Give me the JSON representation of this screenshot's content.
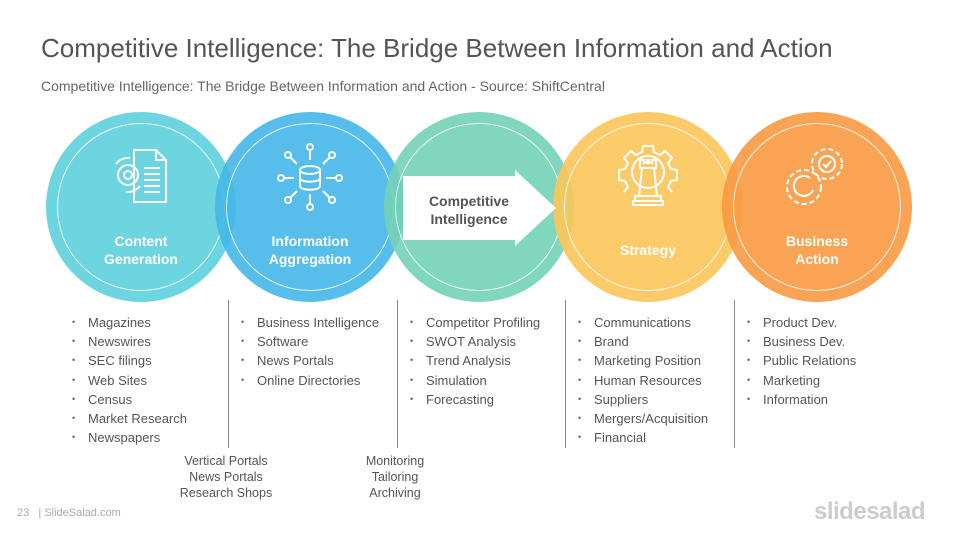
{
  "title": "Competitive Intelligence: The Bridge Between Information and Action",
  "subtitle": "Competitive Intelligence: The Bridge Between Information and Action - Source: ShiftCentral",
  "stages": [
    {
      "label1": "Content",
      "label2": "Generation",
      "color": "#5DD1DC",
      "icon": "document-gear-icon",
      "items": [
        "Magazines",
        "Newswires",
        "SEC filings",
        "Web Sites",
        "Census",
        "Market Research",
        "Newspapers"
      ]
    },
    {
      "label1": "Information",
      "label2": "Aggregation",
      "color": "#45B8EA",
      "icon": "database-aggregation-icon",
      "items": [
        "Business Intelligence",
        "Software",
        "News Portals",
        "Online Directories"
      ]
    },
    {
      "label1": "Competitive",
      "label2": "Intelligence",
      "color": "#74D3B6",
      "icon": "arrow-right-icon",
      "items": [
        "Competitor Profiling",
        "SWOT Analysis",
        "Trend Analysis",
        "Simulation",
        "Forecasting"
      ]
    },
    {
      "label1": "Strategy",
      "label2": "",
      "color": "#FBC65A",
      "icon": "chess-rook-gear-icon",
      "items": [
        "Communications",
        "Brand",
        "Marketing Position",
        "Human Resources",
        "Suppliers",
        "Mergers/Acquisition",
        "Financial"
      ]
    },
    {
      "label1": "Business",
      "label2": "Action",
      "color": "#F99A43",
      "icon": "gears-check-icon",
      "items": [
        "Product Dev.",
        "Business Dev.",
        "Public Relations",
        "Marketing",
        "Information"
      ]
    }
  ],
  "connectors": [
    {
      "lines": [
        "Vertical Portals",
        "News Portals",
        "Research Shops"
      ]
    },
    {
      "lines": [
        "Monitoring",
        "Tailoring",
        "Archiving"
      ]
    }
  ],
  "footer": {
    "page": "23",
    "site": "| SlideSalad.com",
    "brand": "slidesalad"
  }
}
